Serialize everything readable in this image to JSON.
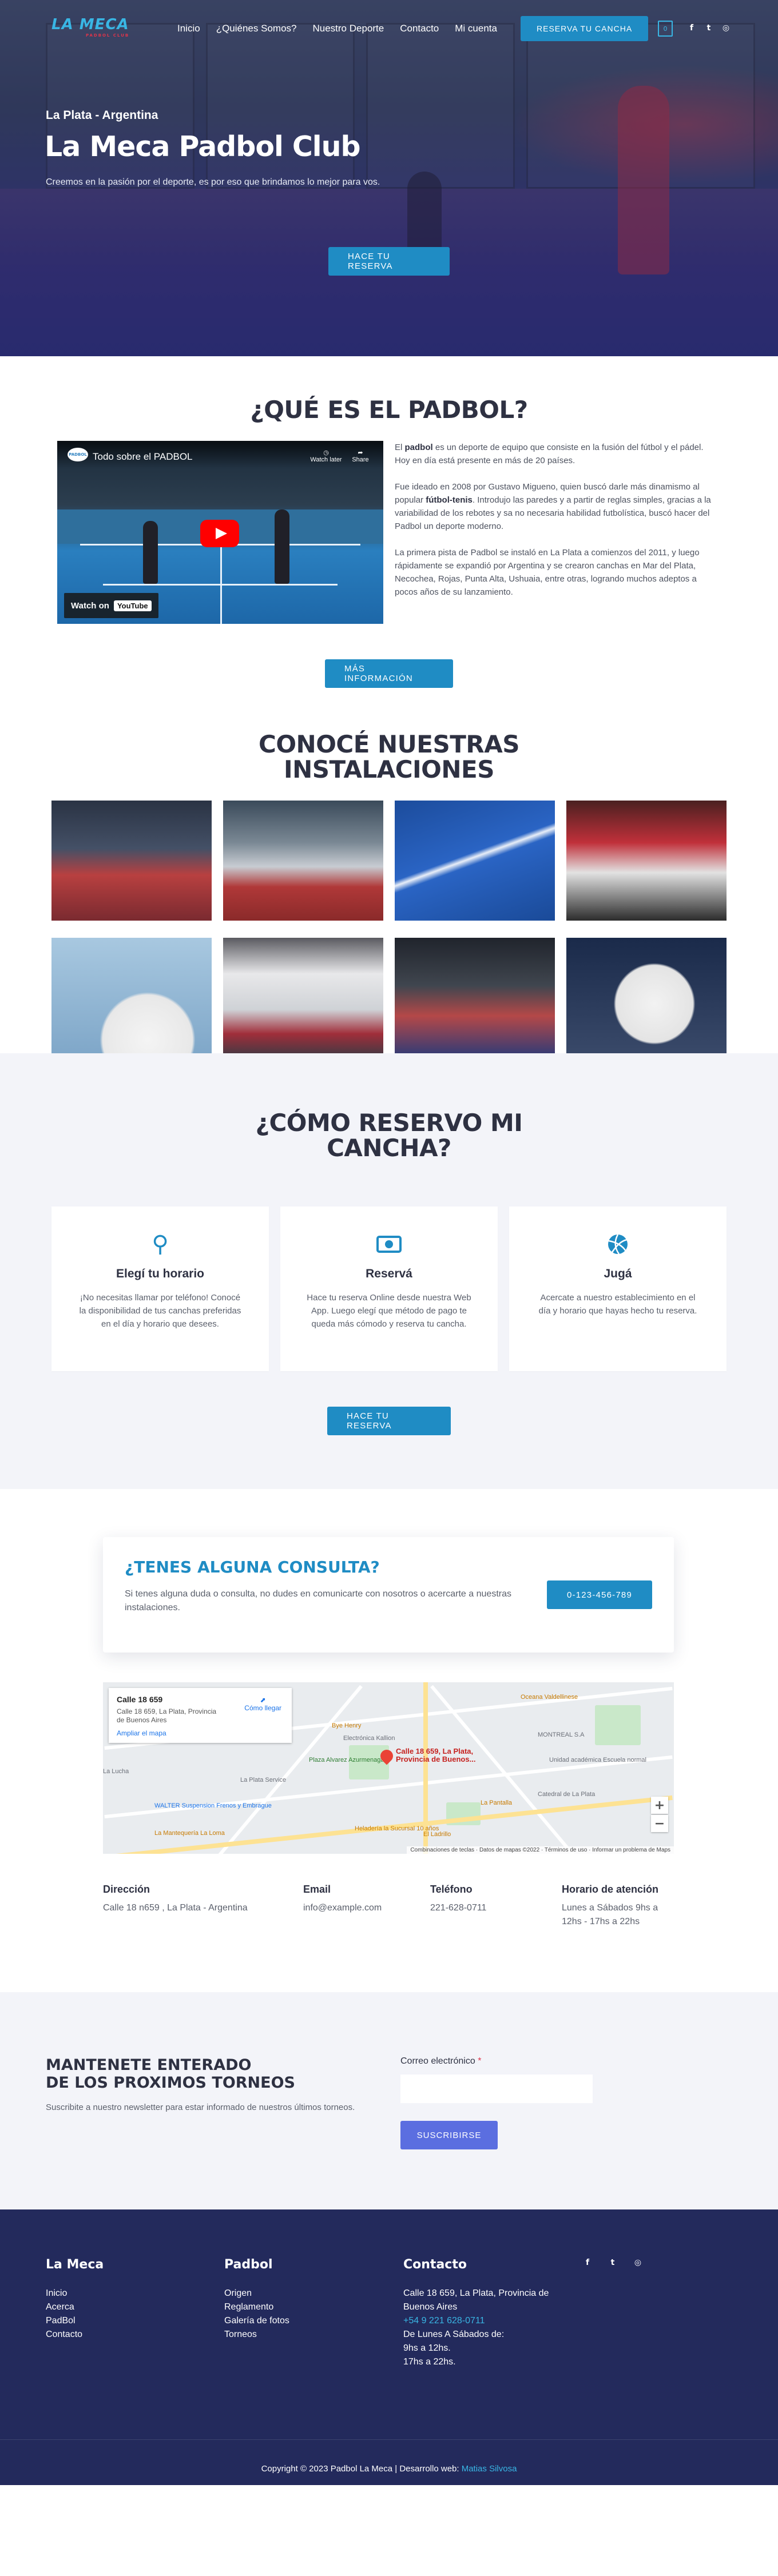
{
  "nav": {
    "logo_text": "LA MECA",
    "logo_sub": "PADBOL CLUB",
    "items": [
      "Inicio",
      "¿Quiénes Somos?",
      "Nuestro Deporte",
      "Contacto",
      "Mi cuenta"
    ],
    "cta": "RESERVA TU CANCHA",
    "cart_count": "0",
    "social": [
      "facebook-icon",
      "twitter-icon",
      "instagram-icon"
    ]
  },
  "hero": {
    "subtitle": "La Plata - Argentina",
    "title": "La Meca Padbol Club",
    "description": "Creemos en la pasión por el deporte, es por eso que brindamos lo mejor para vos.",
    "button": "HACE TU RESERVA"
  },
  "what": {
    "title": "¿QUÉ ES EL PADBOL?",
    "video": {
      "channel": "PADBOL",
      "title": "Todo sobre el PADBOL",
      "watch_later": "Watch later",
      "share": "Share",
      "watch_on": "Watch on",
      "youtube": "YouTube"
    },
    "p1_a": "El ",
    "p1_b": "padbol",
    "p1_c": " es un deporte de equipo que consiste en la fusión del fútbol y el pádel. Hoy en día está presente en más de 20 países.",
    "p2_a": "Fue ideado en 2008 por Gustavo Migueno, quien buscó darle más dinamismo al popular ",
    "p2_b": "fútbol-tenis",
    "p2_c": ". Introdujo las paredes y a partir de reglas simples, gracias a la variabilidad de los rebotes y sa no necesaria habilidad futbolística, buscó hacer del Padbol un deporte moderno.",
    "p3": "La primera pista de Padbol se instaló en La Plata a comienzos del 2011, y luego rápidamente se expandió por Argentina y se crearon canchas en Mar del Plata, Necochea, Rojas, Punta Alta, Ushuaia, entre otras, logrando muchos adeptos a pocos años de su lanzamiento.",
    "button": "MÁS INFORMACIÓN"
  },
  "instalaciones": {
    "title_l1": "CONOCÉ NUESTRAS",
    "title_l2": "INSTALACIONES"
  },
  "reserva": {
    "title_l1": "¿CÓMO RESERVO MI",
    "title_l2": "CANCHA?",
    "cards": [
      {
        "icon": "search-icon",
        "title": "Elegí tu horario",
        "text": "¡No necesitas llamar por teléfono! Conocé la disponibilidad de tus canchas preferidas en el día y horario que desees."
      },
      {
        "icon": "money-bill-icon",
        "title": "Reservá",
        "text": "Hace tu reserva Online desde nuestra Web App. Luego elegí que método de pago te queda más cómodo y reserva tu cancha."
      },
      {
        "icon": "volleyball-icon",
        "title": "Jugá",
        "text": "Acercate a nuestro establecimiento en el día y horario que hayas hecho tu reserva."
      }
    ],
    "button": "HACE TU RESERVA"
  },
  "contact": {
    "title": "¿TENES ALGUNA CONSULTA?",
    "text": "Si tenes alguna duda o consulta, no dudes en comunicarte con nosotros o acercarte a nuestras instalaciones.",
    "phone_button": "0-123-456-789",
    "map": {
      "place": "Calle 18 659",
      "address": "Calle 18 659, La Plata, Provincia de Buenos Aires",
      "directions": "Cómo llegar",
      "bigger": "Ampliar el mapa",
      "pin_label_1": "Calle 18 659, La Plata,",
      "pin_label_2": "Provincia de Buenos...",
      "labels": [
        "Oceana Valdellinese",
        "Bye Henry",
        "Electrónica Kallion",
        "MONTREAL S.A",
        "Plaza Alvarez Azurmenaga",
        "Unidad académica Escuela normal",
        "La Plata Service",
        "La Lucha",
        "WALTER Suspension Frenos y Embrague",
        "La Pantalla",
        "Catedral de La Plata",
        "Heladería la Sucursal 10 años",
        "El Ladrillo",
        "La Mantequería La Loma"
      ],
      "attribution_1": "Combinaciones de teclas",
      "attribution_2": "Datos de mapas ©2022",
      "attribution_3": "Términos de uso",
      "attribution_4": "Informar un problema de Maps"
    },
    "info": [
      {
        "label": "Dirección",
        "value": "Calle 18 n659 , La Plata - Argentina"
      },
      {
        "label": "Email",
        "value": "info@example.com"
      },
      {
        "label": "Teléfono",
        "value": "221-628-0711"
      },
      {
        "label": "Horario de atención",
        "value": "Lunes a Sábados 9hs a 12hs - 17hs a 22hs"
      }
    ]
  },
  "newsletter": {
    "title_l1": "MANTENETE ENTERADO",
    "title_l2": "DE LOS PROXIMOS TORNEOS",
    "text": "Suscribite a nuestro newsletter para estar informado de nuestros últimos torneos.",
    "email_label": "Correo electrónico",
    "required_mark": "*",
    "email_value": "",
    "button": "SUSCRIBIRSE"
  },
  "footer": {
    "col1": {
      "title": "La Meca",
      "links": [
        "Inicio",
        "Acerca",
        "PadBol",
        "Contacto"
      ]
    },
    "col2": {
      "title": "Padbol",
      "links": [
        "Origen",
        "Reglamento",
        "Galería de fotos",
        "Torneos"
      ]
    },
    "col3": {
      "title": "Contacto",
      "address": "Calle 18 659, La Plata, Provincia de Buenos Aires",
      "phone": "+54 9 221 628-0711",
      "hours_1": "De Lunes A Sábados de:",
      "hours_2": "9hs a 12hs.",
      "hours_3": "17hs a 22hs."
    },
    "social": [
      "facebook-icon",
      "twitter-icon",
      "instagram-icon"
    ],
    "copyright": "Copyright © 2023 Padbol La Meca | Desarrollo web: ",
    "developer": "Matias Silvosa"
  },
  "colors": {
    "accent": "#1f8cc4",
    "heading": "#2e3142",
    "soft_bg": "#f3f4f9",
    "footer_bg": "#232a5c",
    "subscribe": "#5b6ee0"
  }
}
